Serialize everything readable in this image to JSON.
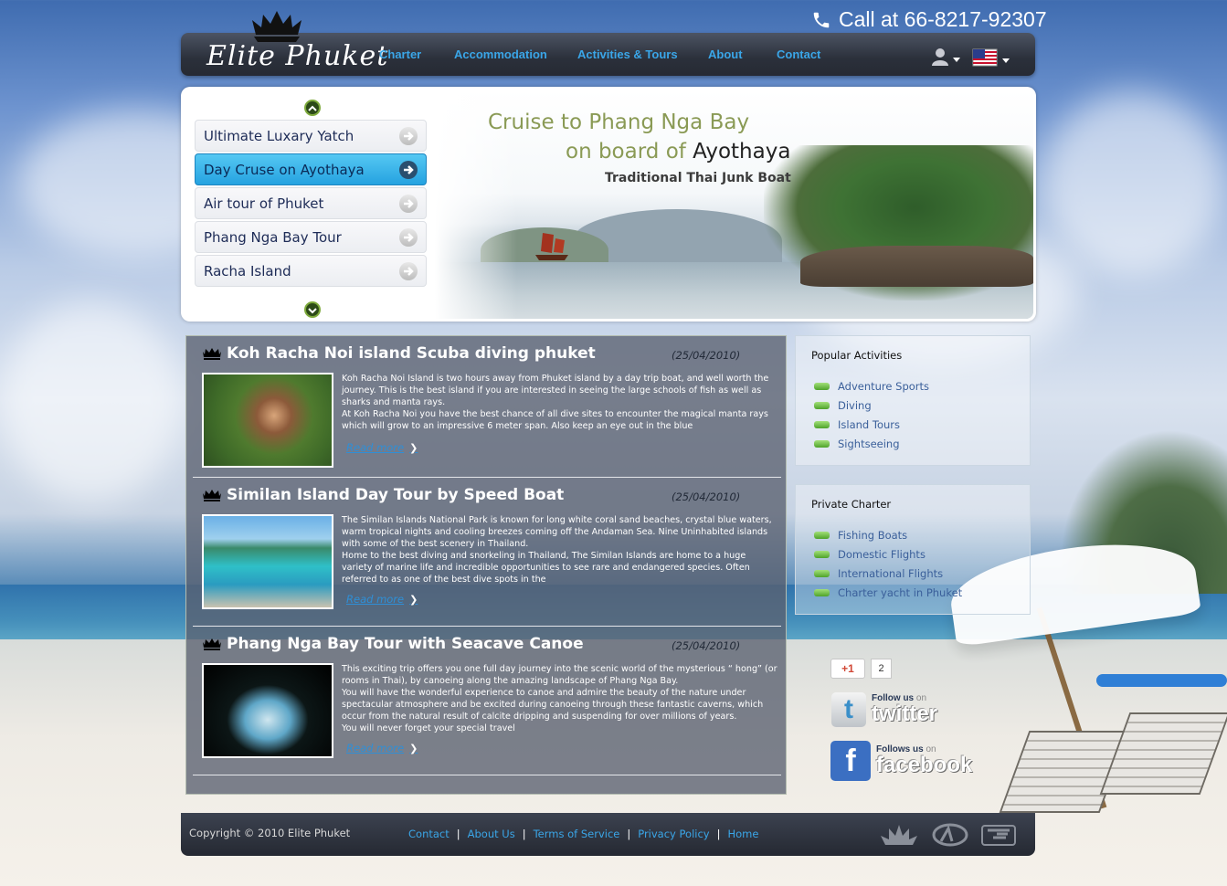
{
  "header": {
    "phone": "Call at 66-8217-92307",
    "logo_text": "Elite Phuket",
    "nav": [
      {
        "label": "Charter"
      },
      {
        "label": "Accommodation"
      },
      {
        "label": "Activities & Tours"
      },
      {
        "label": "About"
      },
      {
        "label": "Contact"
      }
    ]
  },
  "slider": {
    "items": [
      {
        "label": "Ultimate Luxary Yatch",
        "active": false
      },
      {
        "label": "Day Cruse on Ayothaya",
        "active": true
      },
      {
        "label": "Air tour of Phuket",
        "active": false
      },
      {
        "label": "Phang Nga Bay Tour",
        "active": false
      },
      {
        "label": "Racha Island",
        "active": false
      }
    ],
    "banner": {
      "line1": "Cruise to Phang Nga Bay",
      "line2_prefix": "on board of ",
      "line2_strong": "Ayothaya",
      "line3": "Traditional Thai Junk Boat"
    }
  },
  "articles": [
    {
      "title": "Koh Racha Noi island Scuba diving phuket",
      "date": "(25/04/2010)",
      "paragraphs": [
        "Koh Racha Noi Island is two hours away from Phuket island by a day trip boat, and well worth the journey. This is the best island if you are interested in seeing the large schools of fish as well as sharks and manta rays.",
        "At Koh Racha Noi you have the best chance of all dive sites to encounter the magical manta rays which will grow to an impressive 6 meter span. Also keep an eye out in the blue"
      ],
      "read_more": "Read more"
    },
    {
      "title": "Similan Island Day Tour by Speed Boat",
      "date": "(25/04/2010)",
      "paragraphs": [
        "The Similan Islands National Park is known for long white coral sand beaches, crystal blue waters, warm tropical nights and cooling breezes coming off the Andaman Sea. Nine Uninhabited islands with some of the best scenery in Thailand.",
        "Home to the best diving and snorkeling in Thailand, The Similan Islands are home to a huge variety of marine life and incredible opportunities to see rare and endangered species. Often referred to as one of the best dive spots in the"
      ],
      "read_more": "Read more"
    },
    {
      "title": "Phang Nga Bay Tour with Seacave Canoe",
      "date": "(25/04/2010)",
      "paragraphs": [
        "This exciting trip offers you one full day journey into the scenic world of the mysterious “ hong” (or rooms in Thai), by canoeing along the amazing landscape of Phang Nga Bay.",
        "You will have the wonderful experience to canoe and admire the beauty of the nature under spectacular atmosphere and be excited during canoeing through these fantastic caverns, which occur from the natural result of calcite dripping and suspending for over millions of years.",
        "You will never forget your special travel"
      ],
      "read_more": "Read more"
    }
  ],
  "popular_activities": {
    "title": "Popular Activities",
    "items": [
      "Adventure Sports",
      "Diving",
      "Island Tours",
      "Sightseeing"
    ]
  },
  "private_charter": {
    "title": "Private Charter",
    "items": [
      "Fishing Boats",
      "Domestic Flights",
      "International Flights",
      "Charter yacht in Phuket"
    ]
  },
  "social": {
    "gplus_label": "+1",
    "gplus_count": "2",
    "twitter_prefix": "Follow us",
    "twitter_on": "on",
    "twitter_name": "twitter",
    "facebook_prefix": "Follows us",
    "facebook_on": "on",
    "facebook_name": "facebook"
  },
  "footer": {
    "copyright": "Copyright © 2010 Elite Phuket",
    "links": [
      "Contact",
      "About Us",
      "Terms of Service",
      "Privacy Policy",
      "Home"
    ]
  },
  "colors": {
    "nav_link": "#3aa6e8",
    "active_item": "#25a2e0",
    "banner_text": "#8a9a55"
  }
}
